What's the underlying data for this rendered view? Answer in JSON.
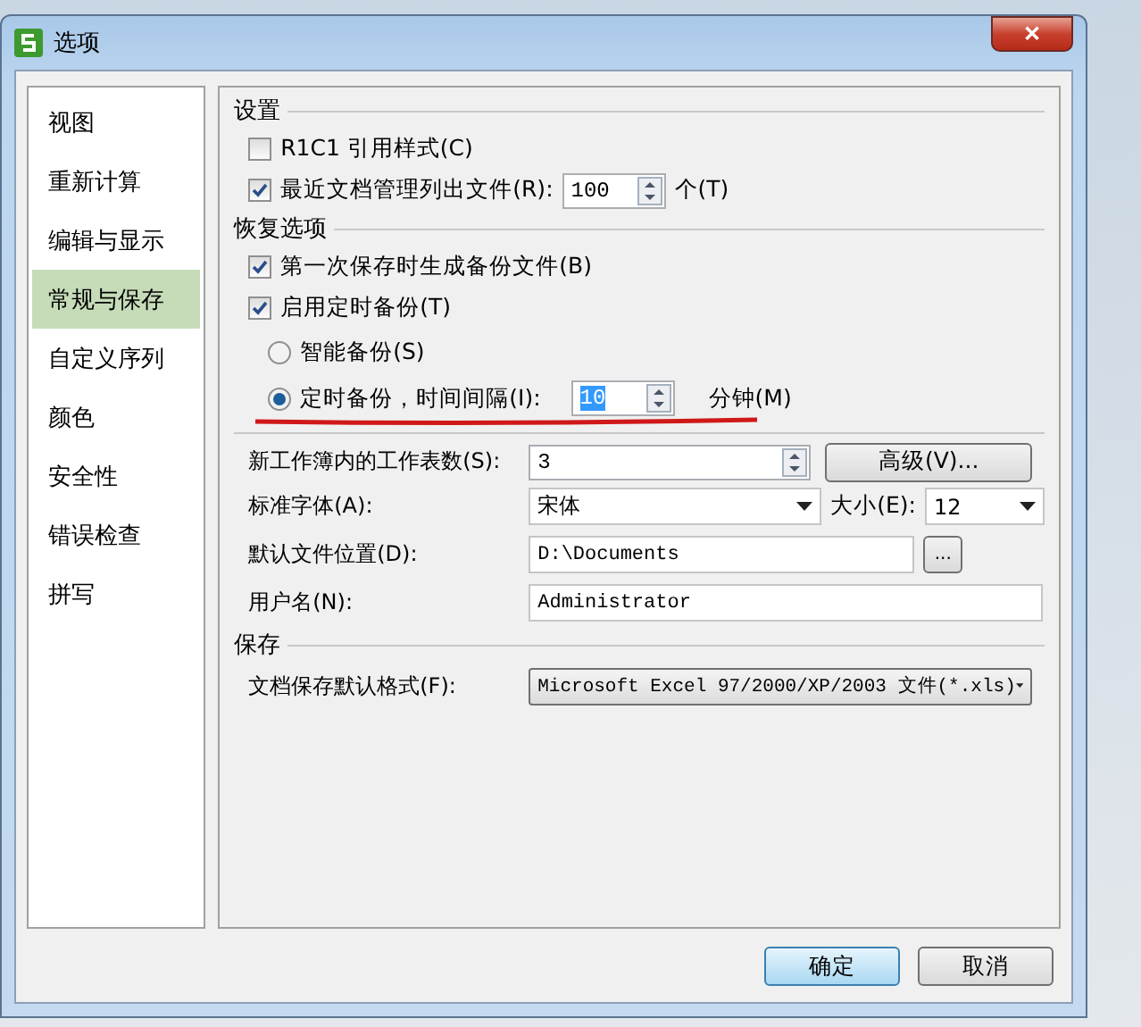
{
  "window": {
    "title": "选项",
    "close": "✕"
  },
  "sidebar": {
    "items": [
      {
        "label": "视图",
        "selected": false
      },
      {
        "label": "重新计算",
        "selected": false
      },
      {
        "label": "编辑与显示",
        "selected": false
      },
      {
        "label": "常规与保存",
        "selected": true
      },
      {
        "label": "自定义序列",
        "selected": false
      },
      {
        "label": "颜色",
        "selected": false
      },
      {
        "label": "安全性",
        "selected": false
      },
      {
        "label": "错误检查",
        "selected": false
      },
      {
        "label": "拼写",
        "selected": false
      }
    ]
  },
  "settings": {
    "title": "设置",
    "r1c1": {
      "label": "R1C1 引用样式(C)",
      "checked": false
    },
    "recent": {
      "label": "最近文档管理列出文件(R):",
      "checked": true,
      "value": "100",
      "unit": "个(T)"
    }
  },
  "recovery": {
    "title": "恢复选项",
    "first_backup": {
      "label": "第一次保存时生成备份文件(B)",
      "checked": true
    },
    "timed_backup": {
      "label": "启用定时备份(T)",
      "checked": true
    },
    "modes": [
      {
        "label": "智能备份(S)",
        "selected": false
      },
      {
        "label": "定时备份，时间间隔(I):",
        "selected": true,
        "value": "10",
        "unit": "分钟(M)"
      }
    ]
  },
  "general": {
    "sheets": {
      "label": "新工作簿内的工作表数(S):",
      "value": "3"
    },
    "advanced_button": "高级(V)...",
    "font": {
      "label": "标准字体(A):",
      "value": "宋体"
    },
    "size": {
      "label": "大小(E):",
      "value": "12"
    },
    "location": {
      "label": "默认文件位置(D):",
      "value": "D:\\Documents",
      "browse": "..."
    },
    "user": {
      "label": "用户名(N):",
      "value": "Administrator"
    }
  },
  "save": {
    "title": "保存",
    "format": {
      "label": "文档保存默认格式(F):",
      "value": "Microsoft Excel 97/2000/XP/2003 文件(*.xls)"
    }
  },
  "buttons": [
    "确定",
    "取消"
  ]
}
